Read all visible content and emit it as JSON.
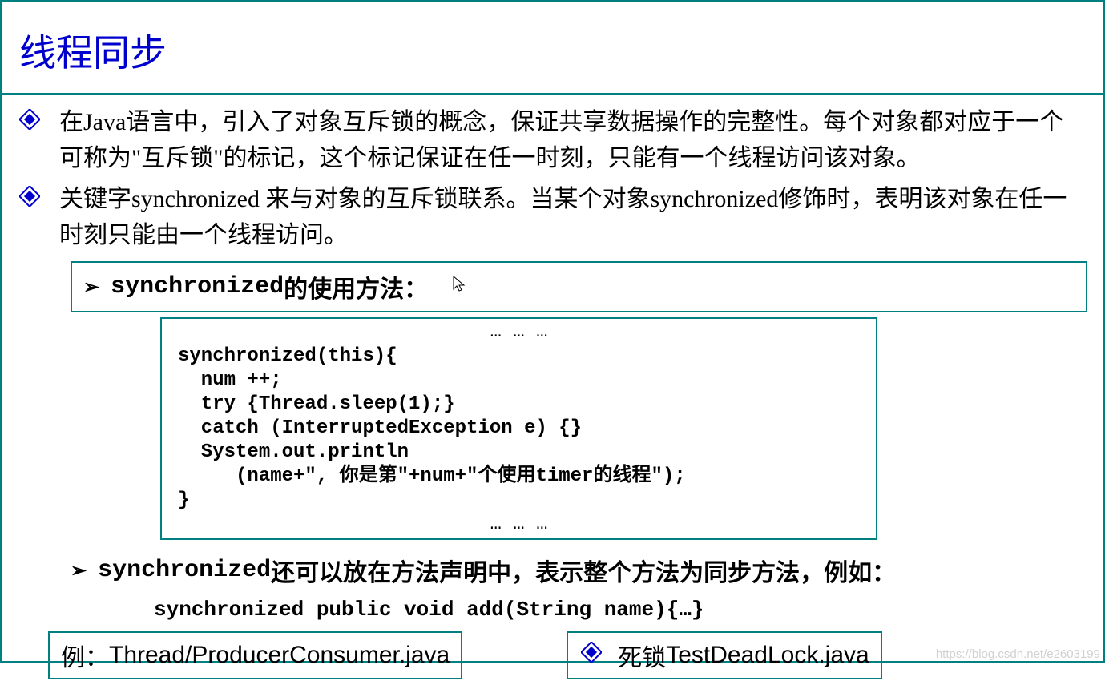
{
  "title": "线程同步",
  "bullets": [
    "在Java语言中，引入了对象互斥锁的概念，保证共享数据操作的完整性。每个对象都对应于一个可称为\"互斥锁\"的标记，这个标记保证在任一时刻，只能有一个线程访问该对象。",
    "关键字synchronized 来与对象的互斥锁联系。当某个对象synchronized修饰时，表明该对象在任一时刻只能由一个线程访问。"
  ],
  "subbox": {
    "keyword": "synchronized",
    "suffix": " 的使用方法："
  },
  "code": {
    "top_ellipsis": "… … …",
    "l1": "synchronized(this){",
    "l2": "  num ++;",
    "l3": "  try {Thread.sleep(1);}",
    "l4": "  catch (InterruptedException e) {}",
    "l5": "  System.out.println",
    "l6": "     (name+\", 你是第\"+num+\"个使用timer的线程\");",
    "l7": "}",
    "bottom_ellipsis": "… … …"
  },
  "subline": {
    "keyword": "synchronized",
    "suffix": " 还可以放在方法声明中，表示整个方法为同步方法，例如："
  },
  "method_line": "synchronized public void add(String name){…}",
  "bottom": {
    "left_prefix": "例： ",
    "left_path": "Thread/ProducerConsumer.java",
    "right_prefix": "死锁",
    "right_path": "TestDeadLock.java"
  },
  "watermark": "https://blog.csdn.net/e2603199"
}
